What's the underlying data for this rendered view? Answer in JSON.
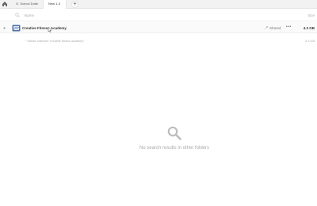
{
  "tabs": [
    {
      "label": "O. School Dutie"
    },
    {
      "label": "New 1-3"
    }
  ],
  "new_tab_label": "+",
  "columns": {
    "name": "Name",
    "size": "Size"
  },
  "result": {
    "title": "Creative Fitness Academy",
    "shared_label": "Shared",
    "more_label": "•••",
    "size": "4.3 GB"
  },
  "sub_row": {
    "text": "* Artistic matches “creative fitness academy”",
    "size": "4.3 GB"
  },
  "empty_state": {
    "message": "No search results in other folders"
  },
  "icons": {
    "home": "home-icon",
    "search": "search-icon",
    "drag": "drag-handle-icon",
    "folder": "folder-icon",
    "cursor": "mouse-cursor-icon",
    "shared": "shared-icon",
    "empty": "magnifier-icon"
  },
  "colors": {
    "tabbar_bg": "#f2f2f2",
    "folder_blue": "#4a6fa5",
    "muted_text": "#a9a9a9"
  }
}
